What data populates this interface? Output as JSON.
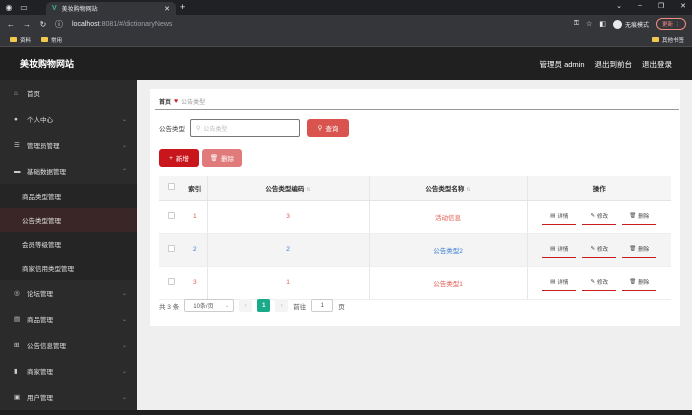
{
  "browser": {
    "tab_title": "美妆购物网站",
    "url_host": "localhost",
    "url_rest": ":8081/#/dictionaryNews",
    "incognito_label": "无痕模式",
    "update_label": "更新",
    "bookmarks": [
      "资料",
      "常用"
    ],
    "other_bookmarks": "其他书签"
  },
  "header": {
    "site_title": "美妆购物网站",
    "admin_label": "管理员 admin",
    "back_front": "退出到前台",
    "logout": "退出登录"
  },
  "sidebar": {
    "items": [
      {
        "label": "首页",
        "icon": "home-icon"
      },
      {
        "label": "个人中心",
        "icon": "user-icon"
      },
      {
        "label": "管理员管理",
        "icon": "sliders-icon"
      },
      {
        "label": "基础数据管理",
        "icon": "monitor-icon"
      }
    ],
    "sub_items": [
      "商品类型管理",
      "公告类型管理",
      "会员等级管理",
      "商家信用类型管理"
    ],
    "items2": [
      {
        "label": "论坛管理",
        "icon": "forum-icon"
      },
      {
        "label": "商品管理",
        "icon": "goods-icon"
      },
      {
        "label": "公告信息管理",
        "icon": "grid-icon"
      },
      {
        "label": "商家管理",
        "icon": "bar-chart-icon"
      },
      {
        "label": "用户管理",
        "icon": "users-icon"
      }
    ]
  },
  "breadcrumb": {
    "home": "首页",
    "current": "公告类型"
  },
  "search": {
    "label": "公告类型",
    "placeholder": "公告类型",
    "query_btn": "查询"
  },
  "actions": {
    "add": "新增",
    "delete": "删除"
  },
  "table": {
    "headers": [
      "索引",
      "公告类型编码",
      "公告类型名称",
      "操作"
    ],
    "rows": [
      {
        "index": "1",
        "code": "3",
        "name": "活动信息"
      },
      {
        "index": "2",
        "code": "2",
        "name": "公告类型2"
      },
      {
        "index": "3",
        "code": "1",
        "name": "公告类型1"
      }
    ],
    "op_labels": {
      "detail": "详情",
      "edit": "修改",
      "delete": "删除"
    }
  },
  "pager": {
    "total": "共 3 条",
    "page_size": "10条/页",
    "current_page": "1",
    "goto_label": "前往",
    "goto_value": "1",
    "page_unit": "页"
  }
}
